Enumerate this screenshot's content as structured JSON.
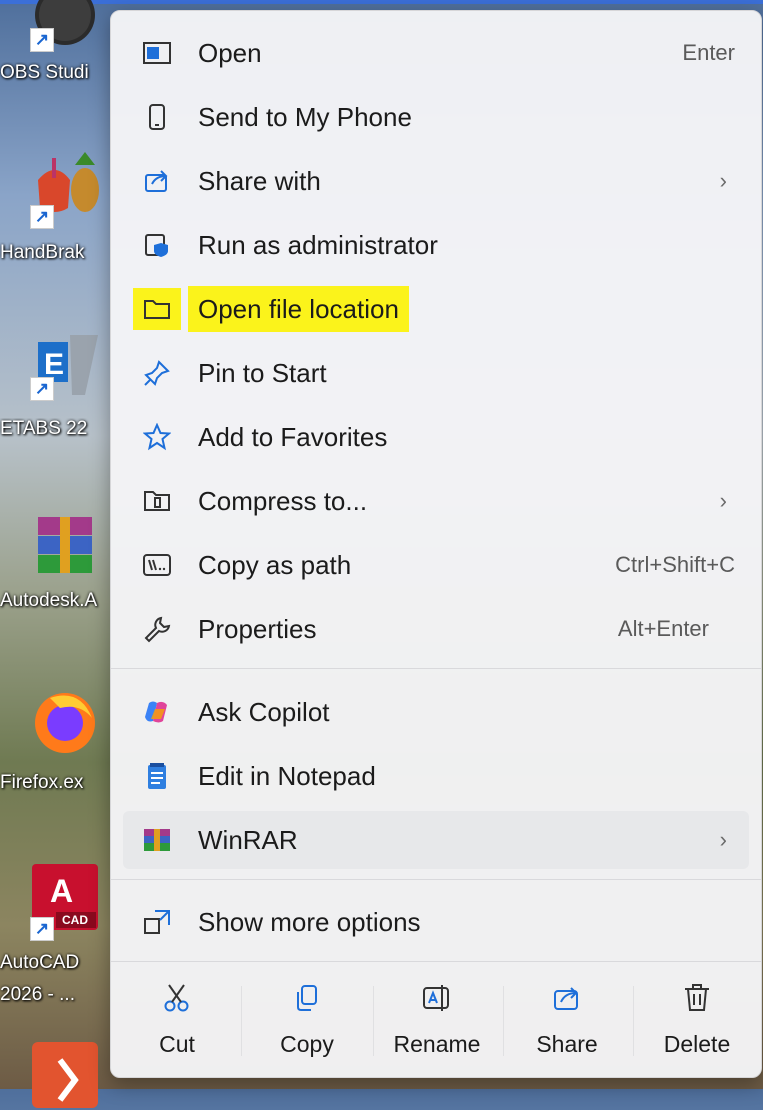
{
  "desktop": {
    "icons": [
      {
        "label": "OBS Studi"
      },
      {
        "label": "HandBrak"
      },
      {
        "label": "ETABS 22"
      },
      {
        "label": "Autodesk.A"
      },
      {
        "label": "Firefox.ex"
      },
      {
        "label": "AutoCAD",
        "label2": "2026 - ..."
      }
    ]
  },
  "menu": {
    "items": [
      {
        "label": "Open",
        "shortcut": "Enter",
        "icon": "open-icon"
      },
      {
        "label": "Send to My Phone",
        "icon": "phone-icon"
      },
      {
        "label": "Share with",
        "chevron": "›",
        "icon": "share-icon"
      },
      {
        "label": "Run as administrator",
        "icon": "shield-icon"
      },
      {
        "label": "Open file location",
        "icon": "folder-icon",
        "highlighted": true
      },
      {
        "label": "Pin to Start",
        "icon": "pin-icon"
      },
      {
        "label": "Add to Favorites",
        "icon": "star-icon"
      },
      {
        "label": "Compress to...",
        "chevron": "›",
        "icon": "zip-icon"
      },
      {
        "label": "Copy as path",
        "shortcut": "Ctrl+Shift+C",
        "icon": "path-icon"
      },
      {
        "label": "Properties",
        "shortcut": "Alt+Enter",
        "icon": "wrench-icon"
      }
    ],
    "items2": [
      {
        "label": "Ask Copilot",
        "icon": "copilot-icon"
      },
      {
        "label": "Edit in Notepad",
        "icon": "notepad-icon"
      },
      {
        "label": "WinRAR",
        "chevron": "›",
        "icon": "winrar-icon"
      }
    ],
    "more": {
      "label": "Show more options",
      "icon": "more-options-icon"
    },
    "bottom": [
      {
        "label": "Cut",
        "icon": "scissors-icon"
      },
      {
        "label": "Copy",
        "icon": "copy-icon"
      },
      {
        "label": "Rename",
        "icon": "rename-icon"
      },
      {
        "label": "Share",
        "icon": "share-icon"
      },
      {
        "label": "Delete",
        "icon": "trash-icon"
      }
    ]
  },
  "colors": {
    "highlight": "#fbf31b",
    "accent": "#3b6fd8"
  }
}
